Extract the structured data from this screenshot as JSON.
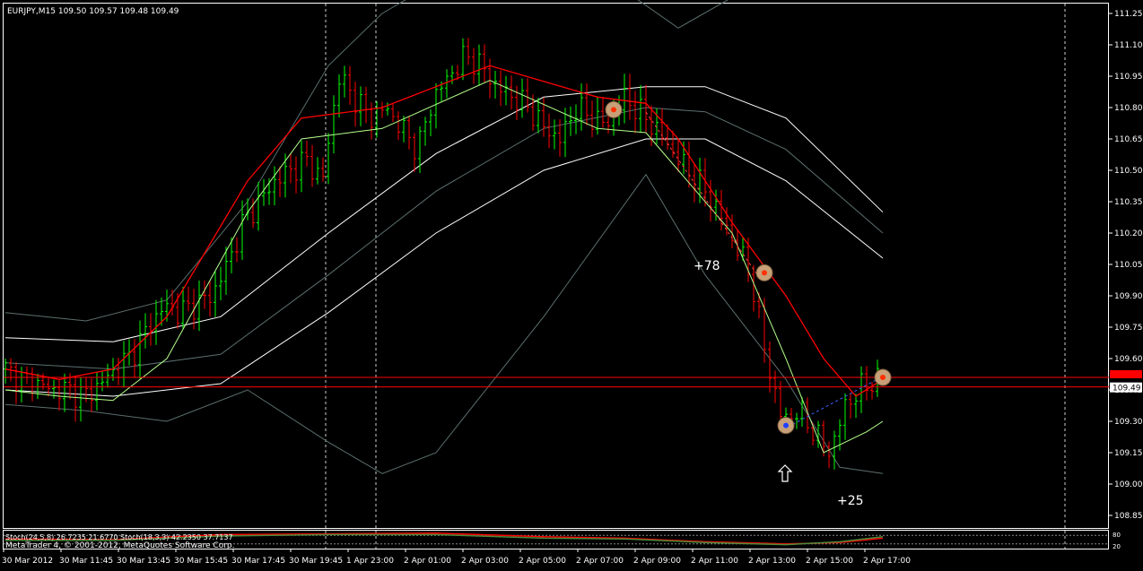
{
  "window": {
    "header": "EURJPY,M15  109.50 109.57 109.48 109.49",
    "copyright": "MetaTrader 4, © 2001-2012, MetaQuotes Software Corp.",
    "stoch_label": "Stoch(24,5,8) 26.7235 21.6770  Stoch(18,3,3) 42.2350 37.7137"
  },
  "colors": {
    "background": "#000000",
    "grid": "#ffffff",
    "text": "#ffffff",
    "bull": "#00ff00",
    "bear": "#ff0000",
    "ma_red": "#ff0000",
    "ma_green": "#b4ff8c",
    "band_white": "#ffffff",
    "band_gray": "#5c6e6e",
    "price_line": "#ff0000",
    "marker": "#c8a078"
  },
  "chart_data": {
    "type": "candlestick",
    "symbol": "EURJPY",
    "timeframe": "M15",
    "ylim": [
      108.8,
      111.3
    ],
    "y_ticks": [
      "111.25",
      "111.10",
      "110.95",
      "110.80",
      "110.65",
      "110.50",
      "110.35",
      "110.20",
      "110.05",
      "109.90",
      "109.75",
      "109.60",
      "109.45",
      "109.30",
      "109.15",
      "109.00",
      "108.85"
    ],
    "x_ticks": [
      "30 Mar 2012",
      "30 Mar 11:45",
      "30 Mar 13:45",
      "30 Mar 15:45",
      "30 Mar 17:45",
      "30 Mar 19:45",
      "1 Apr 23:00",
      "2 Apr 01:00",
      "2 Apr 03:00",
      "2 Apr 05:00",
      "2 Apr 07:00",
      "2 Apr 09:00",
      "2 Apr 11:00",
      "2 Apr 13:00",
      "2 Apr 15:00",
      "2 Apr 17:00"
    ],
    "current_price": "109.49",
    "red_line_price": 109.51,
    "annotations": [
      "+78",
      "+25"
    ],
    "close_path": [
      109.55,
      109.5,
      109.48,
      109.45,
      109.45,
      109.42,
      109.48,
      109.55,
      109.62,
      109.75,
      109.85,
      109.82,
      109.86,
      109.9,
      110.05,
      110.25,
      110.35,
      110.45,
      110.5,
      110.55,
      110.45,
      110.95,
      110.85,
      110.75,
      110.8,
      110.7,
      110.6,
      110.85,
      110.95,
      111.05,
      111.0,
      110.9,
      110.85,
      110.8,
      110.7,
      110.65,
      110.8,
      110.75,
      110.72,
      110.85,
      110.78,
      110.7,
      110.6,
      110.5,
      110.42,
      110.3,
      110.15,
      110.0,
      109.6,
      109.3,
      109.35,
      109.25,
      109.15,
      109.38,
      109.46,
      109.5
    ],
    "markers": [
      {
        "name": "marker-sell-entry",
        "x": 113,
        "price": 110.79
      },
      {
        "name": "marker-sell-exit",
        "x": 141,
        "price": 110.01
      },
      {
        "name": "marker-buy-entry",
        "x": 145,
        "price": 109.28
      },
      {
        "name": "marker-buy-exit",
        "x": 163,
        "price": 109.51
      }
    ],
    "ma_red": [
      [
        0,
        109.55
      ],
      [
        10,
        109.5
      ],
      [
        20,
        109.55
      ],
      [
        30,
        109.8
      ],
      [
        45,
        110.45
      ],
      [
        55,
        110.75
      ],
      [
        70,
        110.8
      ],
      [
        90,
        111.0
      ],
      [
        110,
        110.85
      ],
      [
        119,
        110.82
      ],
      [
        125,
        110.65
      ],
      [
        135,
        110.25
      ],
      [
        145,
        109.9
      ],
      [
        152,
        109.6
      ],
      [
        158,
        109.42
      ],
      [
        163,
        109.5
      ]
    ],
    "ma_green": [
      [
        0,
        109.45
      ],
      [
        10,
        109.42
      ],
      [
        20,
        109.4
      ],
      [
        30,
        109.6
      ],
      [
        45,
        110.3
      ],
      [
        55,
        110.65
      ],
      [
        70,
        110.7
      ],
      [
        90,
        110.93
      ],
      [
        110,
        110.7
      ],
      [
        119,
        110.68
      ],
      [
        125,
        110.5
      ],
      [
        135,
        110.2
      ],
      [
        145,
        109.6
      ],
      [
        152,
        109.15
      ],
      [
        160,
        109.25
      ],
      [
        163,
        109.3
      ]
    ],
    "band_white_upper": [
      [
        0,
        109.7
      ],
      [
        20,
        109.68
      ],
      [
        40,
        109.8
      ],
      [
        60,
        110.2
      ],
      [
        80,
        110.58
      ],
      [
        100,
        110.85
      ],
      [
        119,
        110.9
      ],
      [
        130,
        110.9
      ],
      [
        145,
        110.75
      ],
      [
        163,
        110.3
      ]
    ],
    "band_white_lower": [
      [
        0,
        109.45
      ],
      [
        20,
        109.42
      ],
      [
        40,
        109.48
      ],
      [
        60,
        109.82
      ],
      [
        80,
        110.2
      ],
      [
        100,
        110.5
      ],
      [
        119,
        110.65
      ],
      [
        130,
        110.65
      ],
      [
        145,
        110.45
      ],
      [
        163,
        110.08
      ]
    ],
    "band_gray_mid": [
      [
        0,
        109.58
      ],
      [
        20,
        109.55
      ],
      [
        40,
        109.62
      ],
      [
        60,
        110.0
      ],
      [
        80,
        110.4
      ],
      [
        100,
        110.7
      ],
      [
        119,
        110.8
      ],
      [
        130,
        110.78
      ],
      [
        145,
        110.6
      ],
      [
        163,
        110.2
      ]
    ],
    "band_gray_outer_upper": [
      [
        0,
        109.82
      ],
      [
        15,
        109.78
      ],
      [
        30,
        109.88
      ],
      [
        45,
        110.35
      ],
      [
        60,
        111.0
      ],
      [
        70,
        111.25
      ],
      [
        90,
        111.55
      ],
      [
        110,
        111.45
      ],
      [
        125,
        111.18
      ],
      [
        140,
        111.4
      ],
      [
        163,
        111.7
      ]
    ],
    "band_gray_outer_lower": [
      [
        0,
        109.38
      ],
      [
        15,
        109.35
      ],
      [
        30,
        109.3
      ],
      [
        45,
        109.45
      ],
      [
        60,
        109.2
      ],
      [
        70,
        109.05
      ],
      [
        80,
        109.15
      ],
      [
        100,
        109.8
      ],
      [
        119,
        110.48
      ],
      [
        130,
        110.0
      ],
      [
        145,
        109.5
      ],
      [
        155,
        109.08
      ],
      [
        163,
        109.05
      ]
    ],
    "stoch_red": [
      [
        0,
        0.55
      ],
      [
        20,
        0.5
      ],
      [
        40,
        0.85
      ],
      [
        60,
        0.9
      ],
      [
        80,
        0.95
      ],
      [
        100,
        0.7
      ],
      [
        115,
        0.6
      ],
      [
        130,
        0.35
      ],
      [
        145,
        0.2
      ],
      [
        155,
        0.3
      ],
      [
        163,
        0.6
      ]
    ],
    "stoch_green": [
      [
        0,
        0.45
      ],
      [
        20,
        0.45
      ],
      [
        40,
        0.75
      ],
      [
        60,
        0.85
      ],
      [
        80,
        0.85
      ],
      [
        100,
        0.6
      ],
      [
        115,
        0.55
      ],
      [
        130,
        0.3
      ],
      [
        145,
        0.15
      ],
      [
        155,
        0.35
      ],
      [
        163,
        0.7
      ]
    ]
  }
}
